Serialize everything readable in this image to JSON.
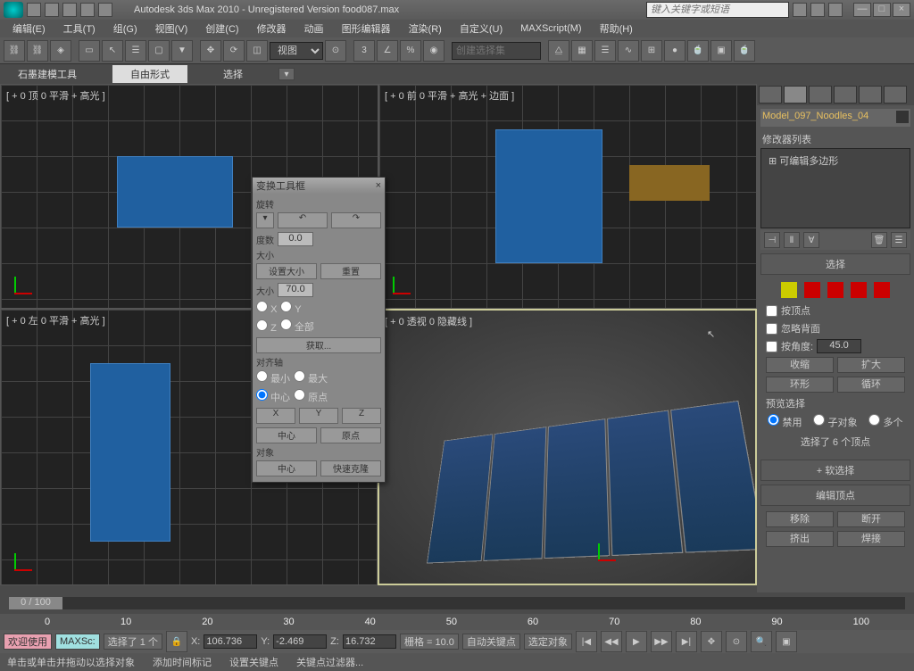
{
  "title": "Autodesk 3ds Max  2010  - Unregistered Version  food087.max",
  "search_placeholder": "键入关键字或短语",
  "menu": [
    "编辑(E)",
    "工具(T)",
    "组(G)",
    "视图(V)",
    "创建(C)",
    "修改器",
    "动画",
    "图形编辑器",
    "渲染(R)",
    "自定义(U)",
    "MAXScript(M)",
    "帮助(H)"
  ],
  "toolbar_dropdown": "视图",
  "create_set": "创建选择集",
  "subtoolbar": {
    "graphite": "石墨建模工具",
    "freeform": "自由形式",
    "select": "选择"
  },
  "viewports": {
    "top": "[ + 0 顶 0 平滑 + 高光 ]",
    "front": "[ + 0 前 0 平滑 + 高光 + 边面 ]",
    "left": "[ + 0 左 0 平滑 + 高光 ]",
    "persp": "[ + 0 透视 0 隐藏线 ]"
  },
  "dialog": {
    "title": "变换工具框",
    "rotate": "旋转",
    "degrees": "度数",
    "deg_val": "0.0",
    "size": "大小",
    "set_size": "设置大小",
    "reset": "重置",
    "size_val": "70.0",
    "x": "X",
    "y": "Y",
    "z": "Z",
    "all": "全部",
    "get": "获取...",
    "align": "对齐轴",
    "min": "最小",
    "max": "最大",
    "center": "中心",
    "origin": "原点",
    "object": "对象",
    "quick_clone": "快速克隆"
  },
  "panel": {
    "obj_name": "Model_097_Noodles_04",
    "mod_list": "修改器列表",
    "editable_poly": "可编辑多边形",
    "selection": "选择",
    "by_vertex": "按顶点",
    "ignore_back": "忽略背面",
    "by_angle": "按角度:",
    "angle_val": "45.0",
    "shrink": "收缩",
    "grow": "扩大",
    "ring": "环形",
    "loop": "循环",
    "preview": "预览选择",
    "disabled": "禁用",
    "subobj": "子对象",
    "multi": "多个",
    "selected_info": "选择了 6 个顶点",
    "soft_sel": "软选择",
    "edit_vert": "编辑顶点",
    "remove": "移除",
    "break": "断开",
    "extrude": "挤出",
    "weld": "焊接"
  },
  "timeline": {
    "handle": "0 / 100",
    "ticks": [
      "0",
      "10",
      "20",
      "30",
      "40",
      "50",
      "60",
      "70",
      "80",
      "90",
      "100"
    ]
  },
  "status": {
    "welcome": "欢迎使用",
    "maxsc": "MAXSc:",
    "sel": "选择了 1 个",
    "x": "106.736",
    "y": "-2.469",
    "z": "16.732",
    "grid": "栅格 = 10.0",
    "autokey": "自动关键点",
    "selkey": "选定对象",
    "addtime": "添加时间标记",
    "setkey": "设置关键点",
    "keyfilter": "关键点过滤器..."
  },
  "hint": "单击或单击并拖动以选择对象"
}
